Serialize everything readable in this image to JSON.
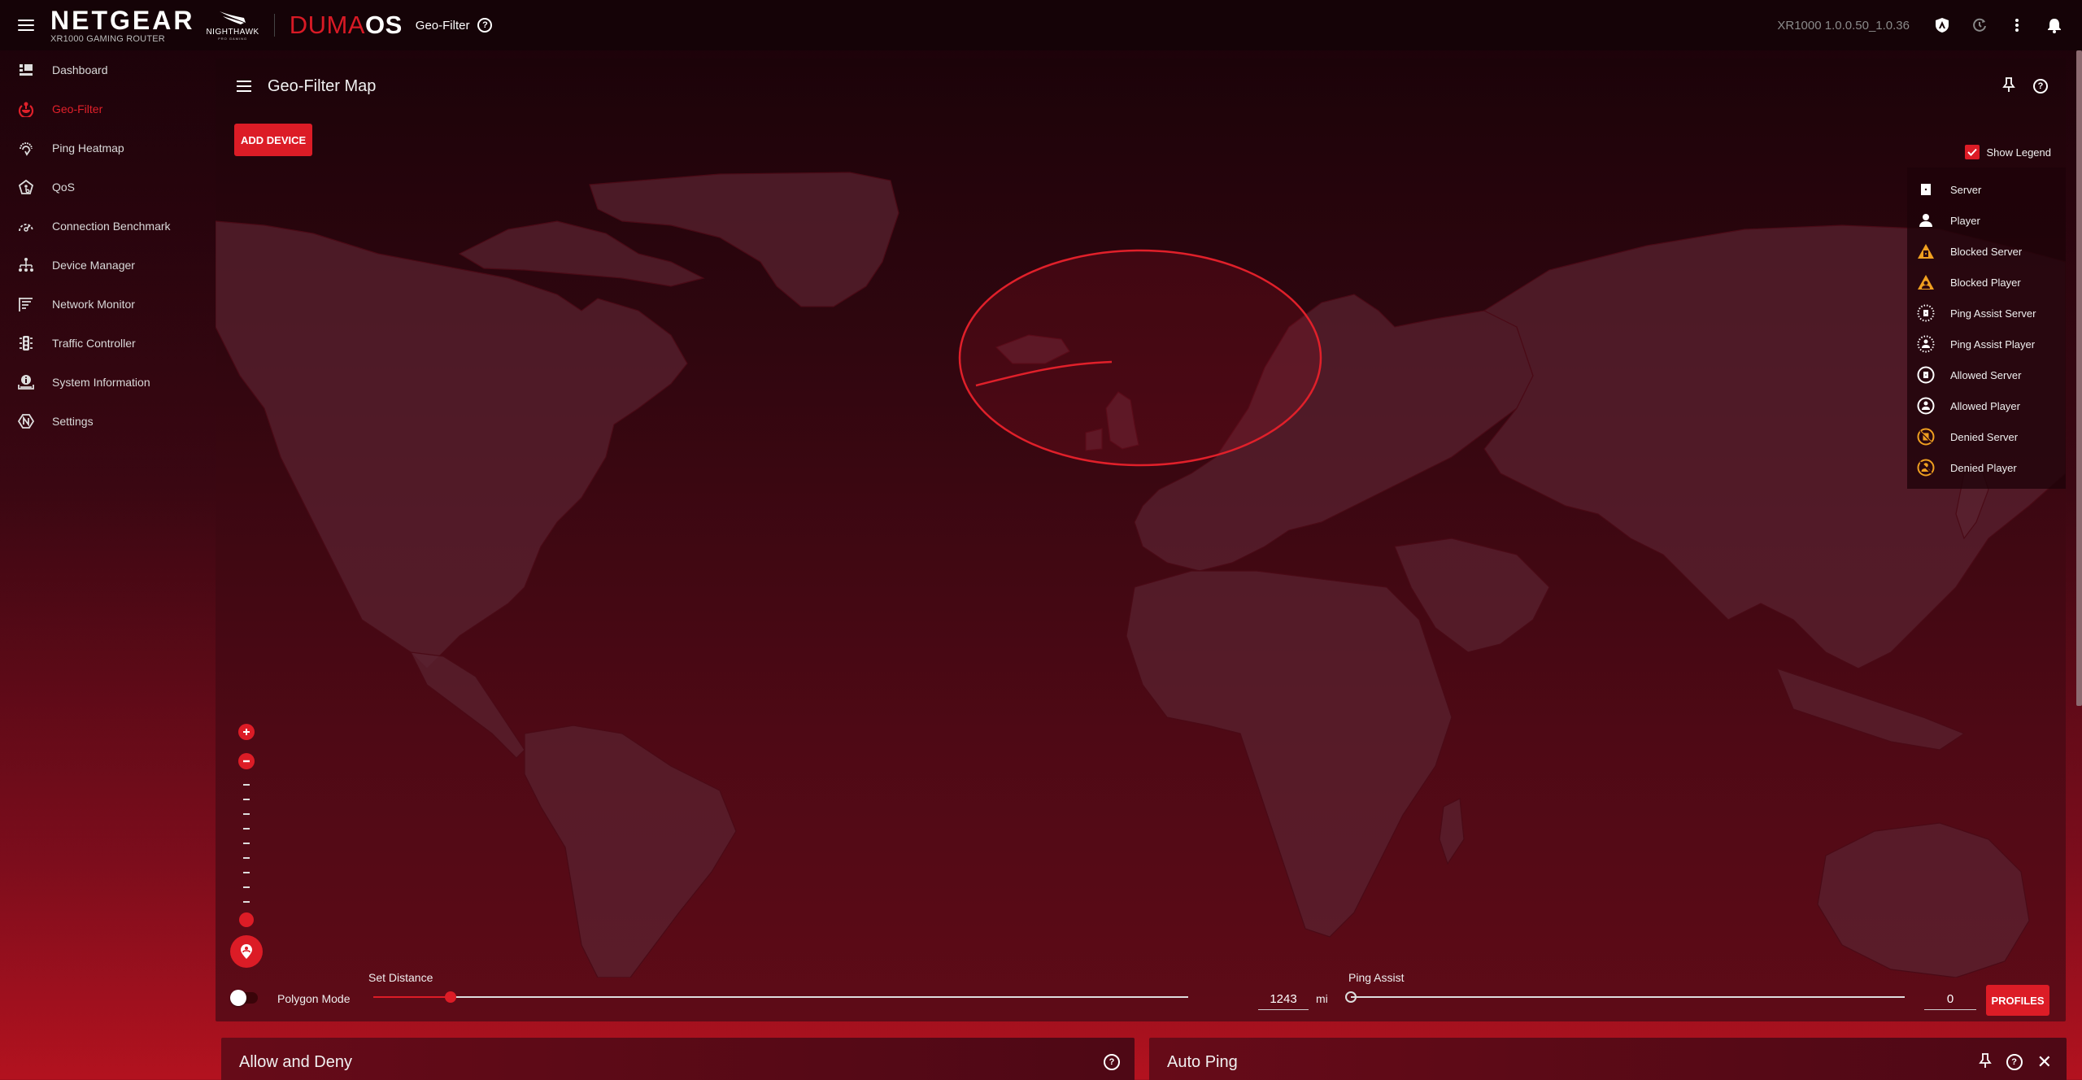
{
  "topbar": {
    "brand": "NETGEAR",
    "brand_sub": "XR1000 GAMING ROUTER",
    "nighthawk": "NIGHTHAWK",
    "nighthawk_sub": "PRO GAMING",
    "os_prefix": "DUMA",
    "os_suffix": "OS",
    "page": "Geo-Filter",
    "firmware": "XR1000 1.0.0.50_1.0.36",
    "icons": [
      "shield-icon",
      "history-icon",
      "more-vert-icon",
      "bell-icon"
    ]
  },
  "sidebar": {
    "items": [
      {
        "label": "Dashboard",
        "icon": "dashboard-icon",
        "active": false
      },
      {
        "label": "Geo-Filter",
        "icon": "geo-filter-icon",
        "active": true
      },
      {
        "label": "Ping Heatmap",
        "icon": "ping-heatmap-icon",
        "active": false
      },
      {
        "label": "QoS",
        "icon": "qos-icon",
        "active": false
      },
      {
        "label": "Connection Benchmark",
        "icon": "speedometer-icon",
        "active": false
      },
      {
        "label": "Device Manager",
        "icon": "device-tree-icon",
        "active": false
      },
      {
        "label": "Network Monitor",
        "icon": "network-monitor-icon",
        "active": false
      },
      {
        "label": "Traffic Controller",
        "icon": "traffic-light-icon",
        "active": false
      },
      {
        "label": "System Information",
        "icon": "system-info-icon",
        "active": false
      },
      {
        "label": "Settings",
        "icon": "netgear-settings-icon",
        "active": false
      }
    ]
  },
  "map_card": {
    "title": "Geo-Filter Map",
    "add_device": "ADD DEVICE",
    "show_legend_label": "Show Legend",
    "show_legend_checked": true,
    "legend": [
      {
        "label": "Server",
        "icon": "server-icon",
        "color": "#ffffff"
      },
      {
        "label": "Player",
        "icon": "player-icon",
        "color": "#ffffff"
      },
      {
        "label": "Blocked Server",
        "icon": "blocked-server-icon",
        "color": "#f0a020"
      },
      {
        "label": "Blocked Player",
        "icon": "blocked-player-icon",
        "color": "#f0a020"
      },
      {
        "label": "Ping Assist Server",
        "icon": "ping-assist-server-icon",
        "color": "#ffffff"
      },
      {
        "label": "Ping Assist Player",
        "icon": "ping-assist-player-icon",
        "color": "#ffffff"
      },
      {
        "label": "Allowed Server",
        "icon": "allowed-server-icon",
        "color": "#ffffff"
      },
      {
        "label": "Allowed Player",
        "icon": "allowed-player-icon",
        "color": "#ffffff"
      },
      {
        "label": "Denied Server",
        "icon": "denied-server-icon",
        "color": "#f0a020"
      },
      {
        "label": "Denied Player",
        "icon": "denied-player-icon",
        "color": "#f0a020"
      }
    ],
    "zoom_level_fraction": 0.0
  },
  "controls": {
    "polygon_mode_label": "Polygon Mode",
    "polygon_mode_on": false,
    "set_distance_label": "Set Distance",
    "distance_value": "1243",
    "distance_unit": "mi",
    "distance_fraction": 0.095,
    "ping_assist_label": "Ping Assist",
    "ping_assist_value": "0",
    "ping_assist_fraction": 0.0,
    "profiles_button": "PROFILES"
  },
  "panels": [
    {
      "title": "Allow and Deny"
    },
    {
      "title": "Auto Ping"
    }
  ],
  "colors": {
    "accent": "#dc1c26",
    "warning": "#f0a020"
  }
}
